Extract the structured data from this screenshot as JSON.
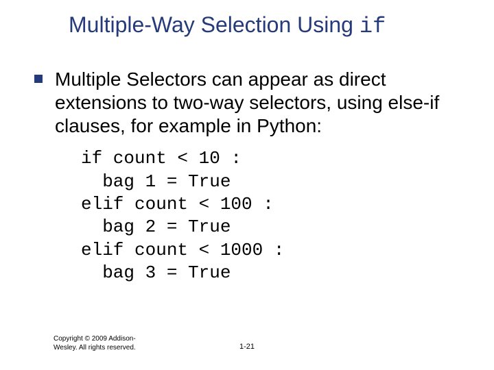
{
  "title": {
    "main": "Multiple-Way Selection Using ",
    "mono": "if"
  },
  "body": {
    "paragraph": "Multiple Selectors can appear as direct extensions to two-way selectors, using else-if clauses, for example in Python:"
  },
  "code": "if count < 10 :\n  bag 1 = True\nelif count < 100 :\n  bag 2 = True\nelif count < 1000 :\n  bag 3 = True",
  "footer": {
    "copyright": "Copyright © 2009 Addison-Wesley. All rights reserved."
  },
  "page_number": "1-21"
}
